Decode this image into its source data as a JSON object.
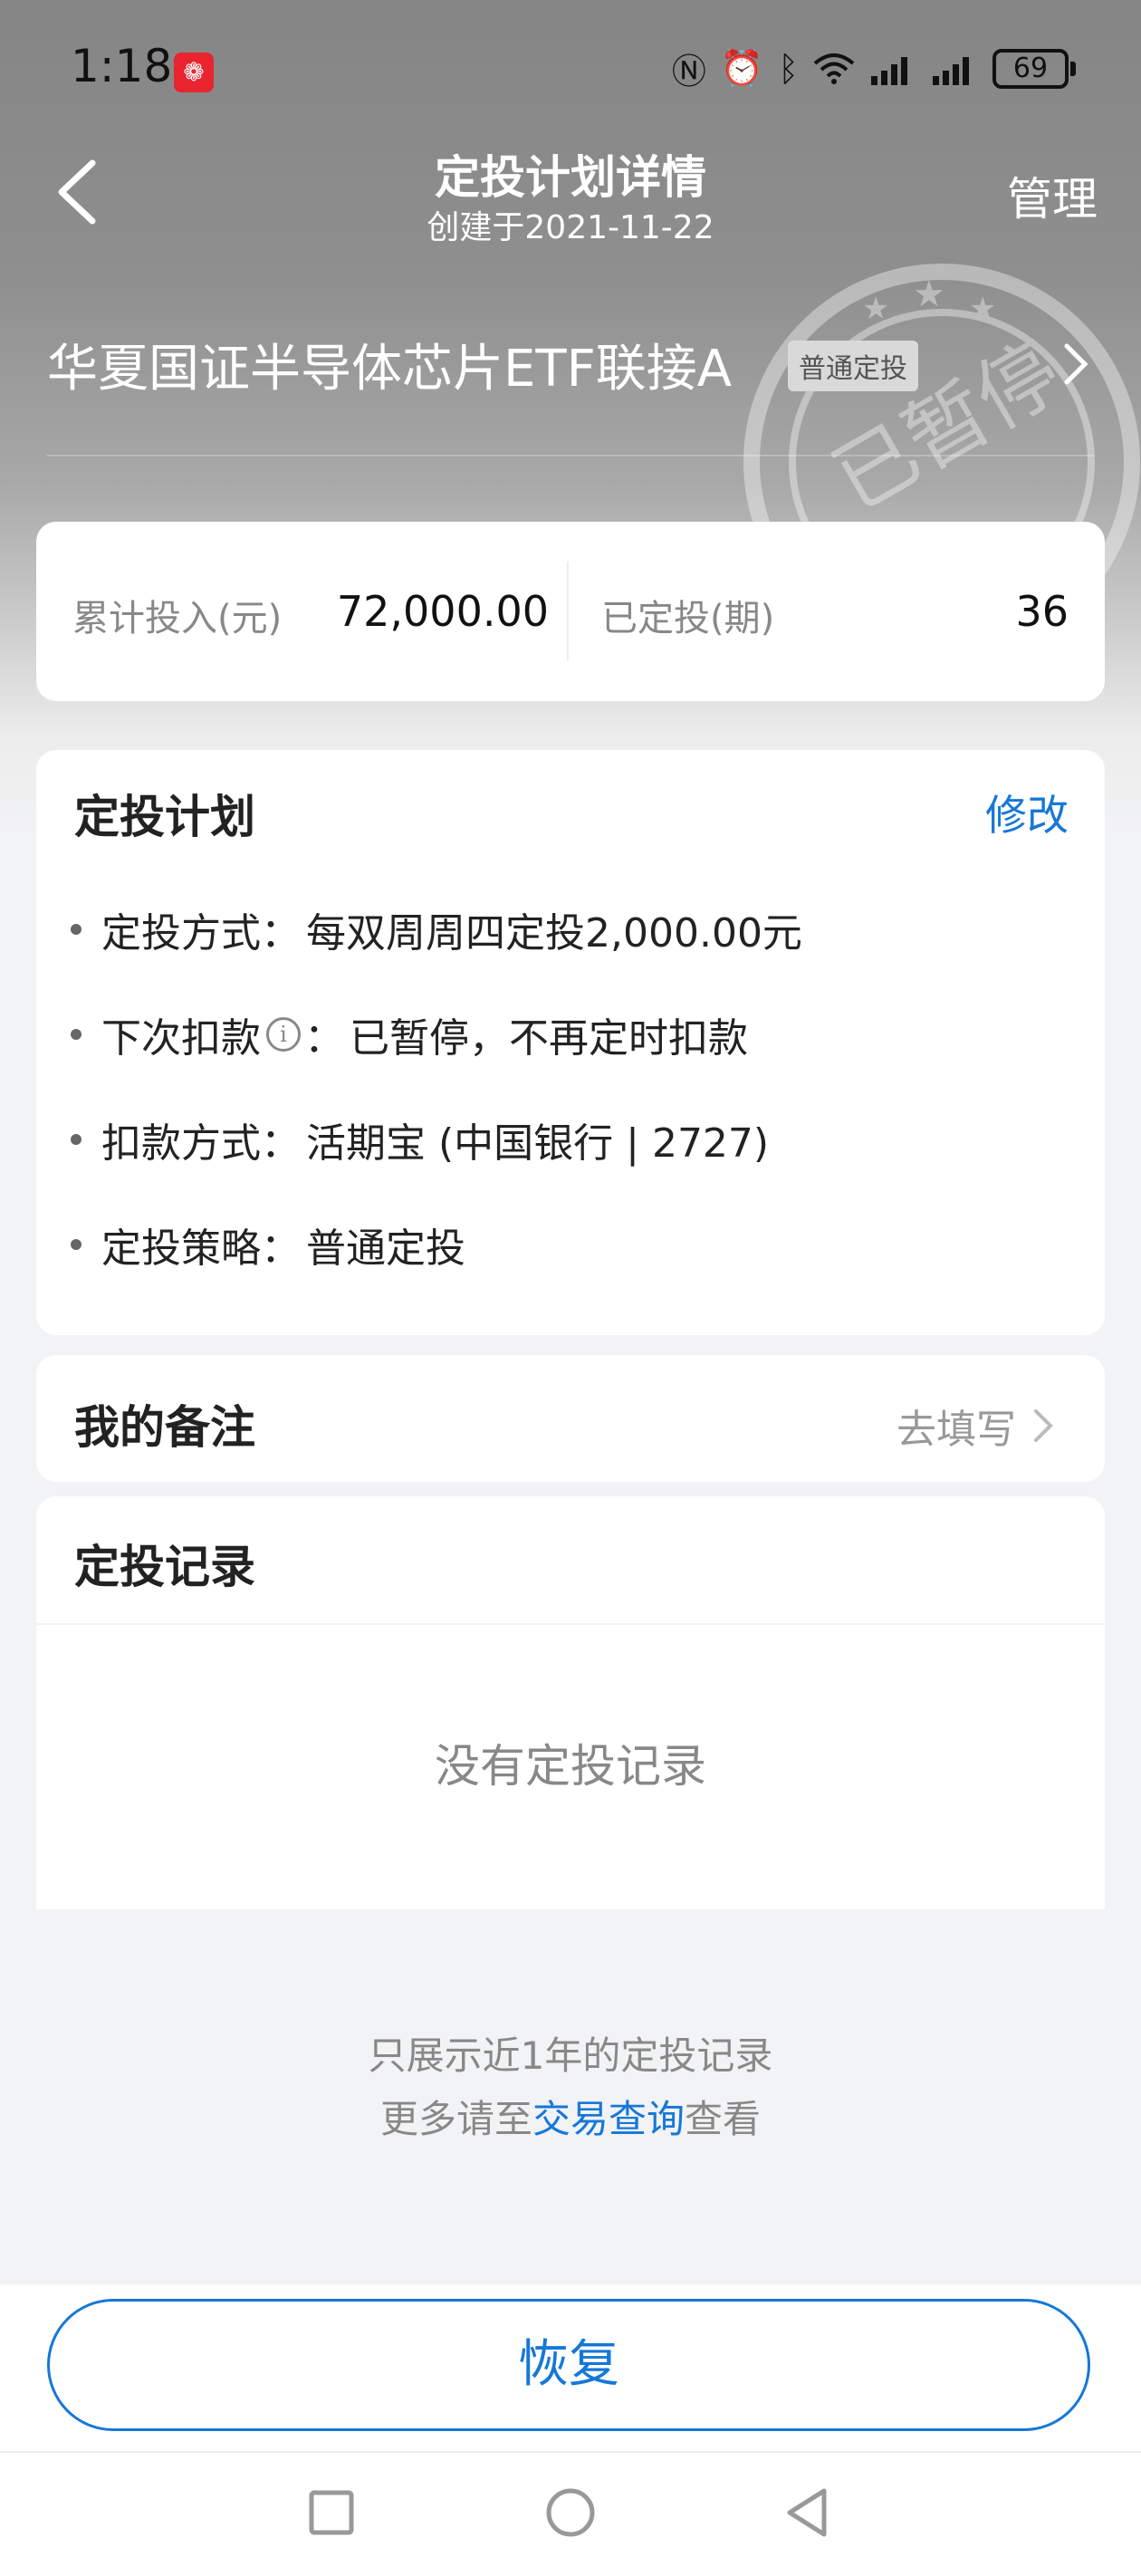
{
  "status_bar": {
    "time": "1:18",
    "battery": "69"
  },
  "nav": {
    "title": "定投计划详情",
    "subtitle": "创建于2021-11-22",
    "manage": "管理"
  },
  "stamp_text": "已暂停",
  "fund": {
    "name": "华夏国证半导体芯片ETF联接A",
    "tag": "普通定投"
  },
  "stats": {
    "total_label": "累计投入(元)",
    "total_value": "72,000.00",
    "periods_label": "已定投(期)",
    "periods_value": "36"
  },
  "plan": {
    "title": "定投计划",
    "edit": "修改",
    "items": [
      {
        "label": "定投方式：",
        "value": "每双周周四定投2,000.00元"
      },
      {
        "label": "下次扣款",
        "suffix": "：",
        "value": "已暂停，不再定时扣款"
      },
      {
        "label": "扣款方式：",
        "value": "活期宝 (中国银行 | 2727)"
      },
      {
        "label": "定投策略：",
        "value": "普通定投"
      }
    ]
  },
  "notes": {
    "title": "我的备注",
    "action": "去填写"
  },
  "records": {
    "title": "定投记录",
    "empty": "没有定投记录"
  },
  "footer": {
    "line1": "只展示近1年的定投记录",
    "line2_prefix": "更多请至",
    "line2_link": "交易查询",
    "line2_suffix": "查看"
  },
  "restore_button": "恢复",
  "colors": {
    "accent": "#1677d8",
    "hero_gray": "#8a8a8a"
  }
}
